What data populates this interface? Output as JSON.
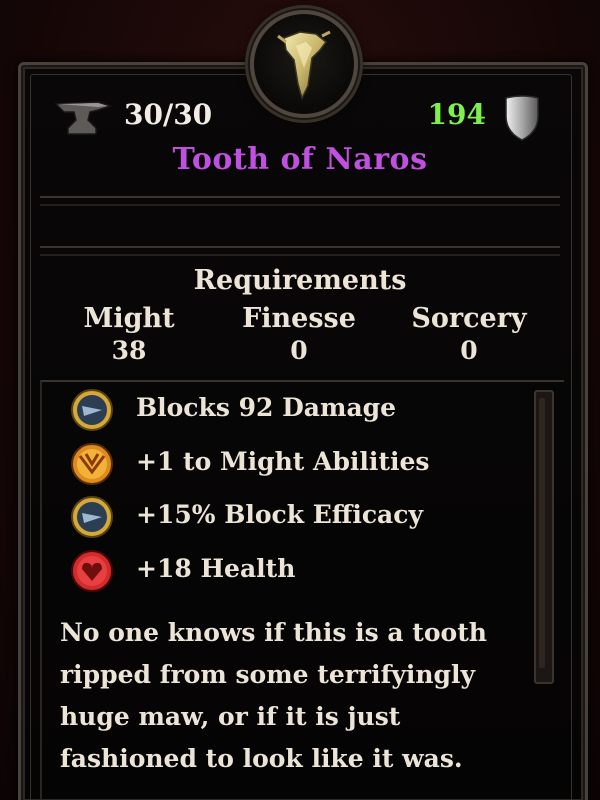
{
  "item": {
    "durability": "30/30",
    "armor": "194",
    "name": "Tooth of Naros",
    "icons": {
      "durability": "anvil-icon",
      "armor": "shield-icon",
      "item": "tooth-icon"
    }
  },
  "requirements": {
    "title": "Requirements",
    "columns": [
      {
        "label": "Might",
        "value": "38"
      },
      {
        "label": "Finesse",
        "value": "0"
      },
      {
        "label": "Sorcery",
        "value": "0"
      }
    ]
  },
  "stats": [
    {
      "text": "Blocks 92 Damage",
      "icon": "block-orb-icon",
      "color": "#d4a83a"
    },
    {
      "text": "+1 to Might Abilities",
      "icon": "might-orb-icon",
      "color": "#e08a20"
    },
    {
      "text": "+15% Block Efficacy",
      "icon": "block-orb-icon",
      "color": "#d4a83a"
    },
    {
      "text": "+18 Health",
      "icon": "health-orb-icon",
      "color": "#d22b2b"
    }
  ],
  "flavor_lines": [
    "No one knows if this is a tooth",
    "ripped from some terrifyingly",
    "huge maw, or if it is just",
    "fashioned to look like it was."
  ],
  "colors": {
    "name": "#c050e0",
    "armor": "#7ef04e",
    "text": "#ece4d6"
  }
}
